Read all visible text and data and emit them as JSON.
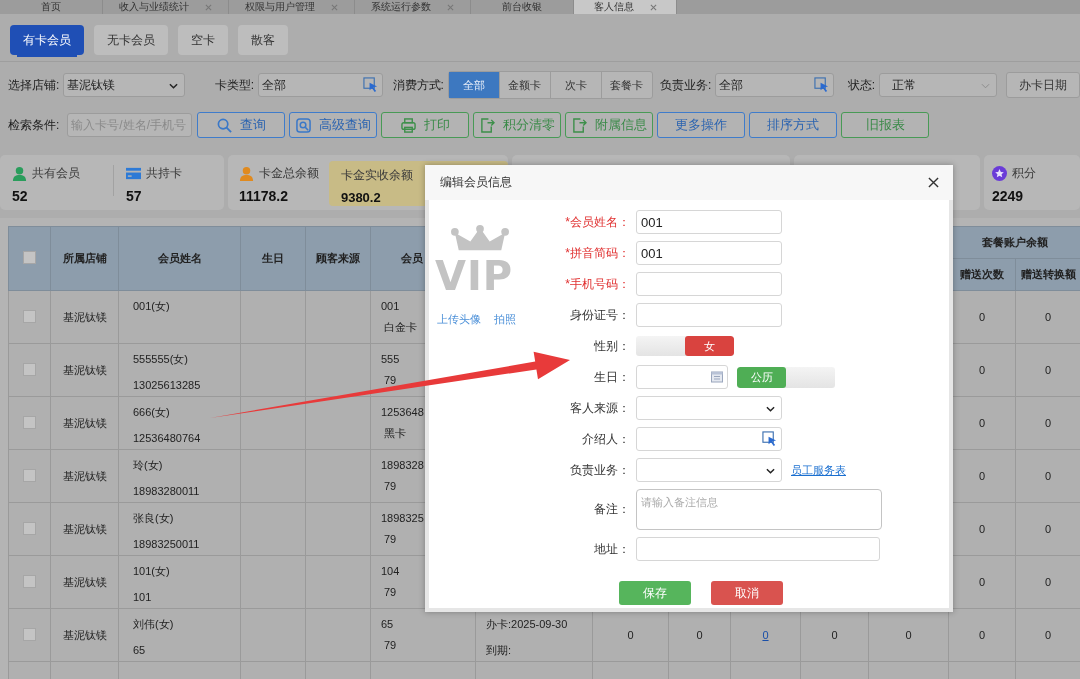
{
  "top_tabs": [
    {
      "label": "首页",
      "selected": false,
      "closable": false
    },
    {
      "label": "收入与业绩统计",
      "selected": false,
      "closable": true
    },
    {
      "label": "权限与用户管理",
      "selected": false,
      "closable": true
    },
    {
      "label": "系统运行参数",
      "selected": false,
      "closable": true
    },
    {
      "label": "前台收银",
      "selected": false,
      "closable": false
    },
    {
      "label": "客人信息",
      "selected": true,
      "closable": true
    }
  ],
  "member_tabs": [
    {
      "label": "有卡会员",
      "selected": true
    },
    {
      "label": "无卡会员",
      "selected": false
    },
    {
      "label": "空卡",
      "selected": false
    },
    {
      "label": "散客",
      "selected": false
    }
  ],
  "filters": {
    "store": {
      "label": "选择店铺:",
      "value": "基泥钛镁"
    },
    "card_type": {
      "label": "卡类型:",
      "value": "全部"
    },
    "consume": {
      "label": "消费方式:",
      "options": [
        {
          "label": "全部",
          "selected": true
        },
        {
          "label": "金额卡",
          "selected": false
        },
        {
          "label": "次卡",
          "selected": false
        },
        {
          "label": "套餐卡",
          "selected": false
        }
      ]
    },
    "staff": {
      "label": "负责业务:",
      "value": "全部"
    },
    "status": {
      "label": "状态:",
      "value": "正常"
    },
    "date_button": "办卡日期"
  },
  "search": {
    "label": "检索条件:",
    "placeholder": "输入卡号/姓名/手机号",
    "buttons": [
      {
        "label": "查询",
        "kind": "search"
      },
      {
        "label": "高级查询",
        "kind": "advanced"
      },
      {
        "label": "打印",
        "kind": "print"
      },
      {
        "label": "积分清零",
        "kind": "export"
      },
      {
        "label": "附属信息",
        "kind": "export"
      },
      {
        "label": "更多操作",
        "kind": "menu"
      },
      {
        "label": "排序方式",
        "kind": "menu"
      },
      {
        "label": "旧报表",
        "kind": "report"
      }
    ]
  },
  "stats": [
    {
      "items": [
        {
          "kind": "person",
          "color": "#2a9d5c",
          "label": "共有会员",
          "value": "52",
          "highlight": false
        },
        {
          "kind": "card",
          "color": "#2d7ad6",
          "label": "共持卡",
          "value": "57",
          "highlight": false
        }
      ]
    },
    {
      "items": [
        {
          "kind": "person",
          "color": "#e08a1e",
          "label": "卡金总余额",
          "value": "11178.2",
          "highlight": false
        },
        {
          "kind": "plain",
          "label": "卡金实收余额",
          "value": "9380.2",
          "highlight": true
        }
      ]
    },
    {
      "items": [
        {
          "kind": "star",
          "color": "#6a3bd8",
          "label": "积分",
          "value": "2249",
          "highlight": false
        }
      ]
    }
  ],
  "table": {
    "all_checked": false,
    "columns": [
      "所属店铺",
      "会员姓名",
      "生日",
      "顾客来源",
      "会员"
    ],
    "group_header": "套餐账户余额",
    "sub_columns": [
      "赠送次数",
      "赠送转换额"
    ],
    "rows": [
      {
        "checked": false,
        "store": "基泥钛镁",
        "name": "001(女)",
        "card_no": "001",
        "card_type": "白金卡",
        "tail": [
          {
            "text": "0",
            "link": false
          },
          {
            "text": "0",
            "link": false
          }
        ]
      },
      {
        "checked": false,
        "store": "基泥钛镁",
        "name": "555555(女)",
        "phone": "13025613285",
        "card_no": "555",
        "card_type": "79",
        "tail": [
          {
            "text": "0",
            "link": false
          },
          {
            "text": "0",
            "link": false
          }
        ]
      },
      {
        "checked": false,
        "store": "基泥钛镁",
        "name": "666(女)",
        "phone": "12536480764",
        "card_no": "1253648",
        "card_type": "黑卡",
        "tail": [
          {
            "text": "0",
            "link": false
          },
          {
            "text": "0",
            "link": false
          }
        ]
      },
      {
        "checked": false,
        "store": "基泥钛镁",
        "name": "玲(女)",
        "phone": "18983280011",
        "card_no": "1898328",
        "card_type": "79",
        "tail": [
          {
            "text": "0",
            "link": false
          },
          {
            "text": "0",
            "link": false
          }
        ]
      },
      {
        "checked": false,
        "store": "基泥钛镁",
        "name": "张良(女)",
        "phone": "18983250011",
        "card_no": "1898325",
        "card_type": "79",
        "tail": [
          {
            "text": "0",
            "link": false
          },
          {
            "text": "0",
            "link": false
          }
        ]
      },
      {
        "checked": false,
        "store": "基泥钛镁",
        "name": "101(女)",
        "phone": "101",
        "card_no": "104",
        "card_type": "79",
        "tail": [
          {
            "text": "0",
            "link": false
          },
          {
            "text": "0",
            "link": false
          }
        ]
      },
      {
        "checked": false,
        "store": "基泥钛镁",
        "name": "刘伟(女)",
        "phone": "65",
        "card_no": "65",
        "card_type": "79",
        "card_date": [
          "办卡:2025-09-30",
          "到期:"
        ],
        "tail": [
          {
            "text": "0",
            "link": false
          },
          {
            "text": "0",
            "link": false
          },
          {
            "text": "0",
            "link": true
          },
          {
            "text": "0",
            "link": false
          },
          {
            "text": "0",
            "link": false
          },
          {
            "text": "0",
            "link": false
          },
          {
            "text": "0",
            "link": false
          }
        ]
      }
    ]
  },
  "dialog": {
    "title": "编辑会员信息",
    "avatar_text": "VIP",
    "links": [
      "上传头像",
      "拍照"
    ],
    "fields": [
      {
        "kind": "text",
        "label": "*会员姓名：",
        "required": true,
        "value": "001"
      },
      {
        "kind": "text",
        "label": "*拼音简码：",
        "required": true,
        "value": "001"
      },
      {
        "kind": "text",
        "label": "*手机号码：",
        "required": true
      },
      {
        "kind": "text",
        "label": "身份证号：",
        "required": false
      },
      {
        "kind": "switch",
        "label": "性别：",
        "required": false,
        "text": "女",
        "on": true
      },
      {
        "kind": "date",
        "label": "生日：",
        "required": false,
        "text": "公历",
        "on": true
      },
      {
        "kind": "select",
        "label": "客人来源：",
        "required": false
      },
      {
        "kind": "picker",
        "label": "介绍人：",
        "required": false
      },
      {
        "kind": "select",
        "label": "负责业务：",
        "required": false,
        "link": "员工服务表"
      },
      {
        "kind": "textarea",
        "label": "备注：",
        "required": false,
        "placeholder": "请输入备注信息"
      },
      {
        "kind": "wide",
        "label": "地址：",
        "required": false
      }
    ],
    "buttons": [
      {
        "label": "保存",
        "kind": "save"
      },
      {
        "label": "取消",
        "kind": "cancel"
      }
    ]
  }
}
